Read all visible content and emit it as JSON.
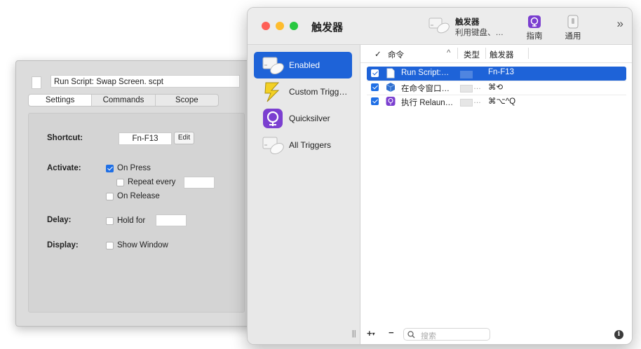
{
  "inspector": {
    "title_field": "Run Script: Swap Screen. scpt",
    "tabs": [
      "Settings",
      "Commands",
      "Scope"
    ],
    "labels": {
      "shortcut": "Shortcut:",
      "activate": "Activate:",
      "delay": "Delay:",
      "display": "Display:"
    },
    "shortcut_value": "Fn-F13",
    "edit_label": "Edit",
    "options": {
      "on_press": "On Press",
      "repeat_every": "Repeat every",
      "on_release": "On Release",
      "hold_for": "Hold for",
      "show_window": "Show Window"
    },
    "checked": {
      "on_press": true,
      "repeat_every": false,
      "on_release": false,
      "hold_for": false,
      "show_window": false
    }
  },
  "window": {
    "title": "触发器",
    "toolbar": {
      "trigger_title": "触发器",
      "trigger_subtitle": "利用键盘、…",
      "guide_label": "指南",
      "general_label": "通用",
      "more": "»"
    },
    "sidebar": {
      "items": [
        {
          "label": "Enabled",
          "icon": "keyboard-mouse-icon",
          "selected": true
        },
        {
          "label": "Custom Trigg…",
          "icon": "lightning-icon",
          "selected": false
        },
        {
          "label": "Quicksilver",
          "icon": "quicksilver-icon",
          "selected": false
        },
        {
          "label": "All Triggers",
          "icon": "keyboard-mouse-icon",
          "selected": false
        }
      ],
      "grip": "|||"
    },
    "table": {
      "headers": {
        "check": "✓",
        "command": "命令",
        "sort": "^",
        "type": "类型",
        "trigger": "触发器"
      },
      "rows": [
        {
          "name": "Run Script:…",
          "trigger": "Fn-F13",
          "icon": "document-icon",
          "checked": true,
          "selected": true
        },
        {
          "name": "在命令窗口…",
          "trigger": "⌘⟲",
          "icon": "cube-icon",
          "checked": true,
          "selected": false
        },
        {
          "name": "执行 Relaun…",
          "trigger": "⌘⌥^Q",
          "icon": "quicksilver-icon",
          "checked": true,
          "selected": false
        }
      ],
      "type_dots": "…"
    },
    "footer": {
      "plus": "+",
      "plus_menu": "▾",
      "minus": "−",
      "search_placeholder": "搜索",
      "info": "i"
    }
  },
  "colors": {
    "accent": "#1e63d8",
    "checkbox": "#1f6fe5",
    "quicksilver": "#7b3fd0"
  }
}
